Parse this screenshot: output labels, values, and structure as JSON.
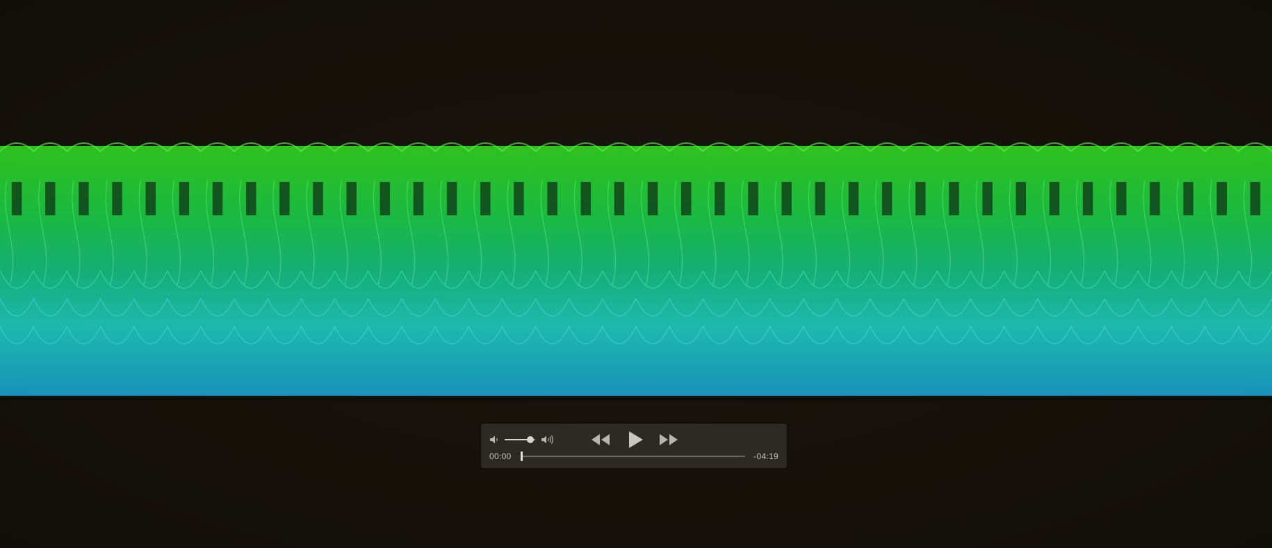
{
  "visualizer": {
    "colors": {
      "top": "#34e022",
      "upper": "#1bd64a",
      "mid": "#15c98a",
      "lower": "#1fd6c8",
      "bottom": "#1aa8d8",
      "background": "#16120b"
    }
  },
  "player": {
    "current_time": "00:00",
    "remaining_time": "-04:19",
    "volume_level": 0.85,
    "progress": 0.0,
    "icons": {
      "volume_low": "speaker-low-icon",
      "volume_high": "speaker-high-icon",
      "rewind": "rewind-icon",
      "play": "play-icon",
      "fast_forward": "fast-forward-icon"
    }
  }
}
